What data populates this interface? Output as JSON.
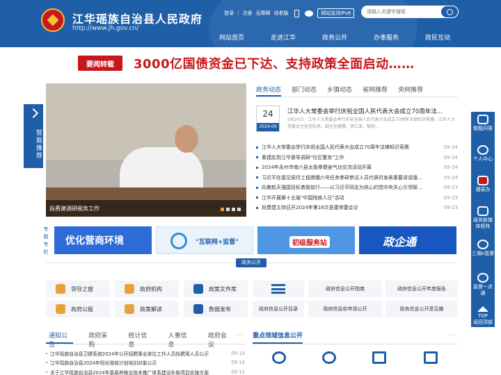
{
  "header": {
    "title": "江华瑶族自治县人民政府",
    "url": "http://www.jh.gov.cn/",
    "links": [
      "登录",
      "注册",
      "无障碍",
      "适老版"
    ],
    "separator": "|",
    "ipv6": "网站支持IPv6",
    "search_placeholder": "请输入关键字搜索",
    "nav": [
      "网站首页",
      "走进江华",
      "政务公开",
      "办事服务",
      "政民互动"
    ]
  },
  "banner": {
    "tag": "要闻转载",
    "headline": "3000亿国债资金已下达、支持政策全面启动……"
  },
  "slideshow": {
    "caption": "段费建调研税务工作"
  },
  "left_float": "智能推荐",
  "news_tabs": [
    "政务动态",
    "部门动态",
    "乡镇动态",
    "省网推荐",
    "央网推荐"
  ],
  "top_news": {
    "day": "24",
    "ym": "2024-09",
    "title": "江华人大常委会举行庆祝全国人民代表大会成立70周年法...",
    "summary": "9月20日，江华人大常委会举行庆祝全国人民代表大会成立70周年法律知识竞赛。江华人大常委会主任任陈承，副主任唐蕾，钟江波，黎刚..."
  },
  "news_list": [
    {
      "title": "江华人大常委会举行庆祝全国人民代表大会成立70周年法律知识竞赛",
      "date": "09-24"
    },
    {
      "title": "秦建彪到江华督导调研\"社区警务\"工作",
      "date": "09-24"
    },
    {
      "title": "2024年永州市南六县太极拳健身气功交流活动开幕",
      "date": "09-24"
    },
    {
      "title": "习近平在接见探月工程嫦娥六号任务参研参试人员代表时发表重要讲话强...",
      "date": "09-24"
    },
    {
      "title": "向着航天强国目标勇毅前行——以习近平同志为核心的党中央关心引领探...",
      "date": "09-23"
    },
    {
      "title": "江华开展第十五届\"中国残疾人日\"活动",
      "date": "09-23"
    },
    {
      "title": "段费建主持召开2024年第18次县委常委会议",
      "date": "09-23"
    }
  ],
  "special_label": "专题专栏",
  "promos": [
    "优化营商环境",
    "\"互联网+监督\"",
    "初级服务站",
    "政企通"
  ],
  "section_title": "政务公开",
  "services": {
    "left": [
      "领导之窗",
      "政府机构",
      "政策文件库",
      "政府公报",
      "政策解读",
      "数据发布"
    ],
    "right": [
      "政府信息公开指南",
      "政府信息公开年度报告",
      "政府信息公开目录",
      "政府信息依申请公开",
      "政务信息公开意见箱"
    ]
  },
  "bottom_tabs": [
    "通知公告",
    "政府采购",
    "统计信息",
    "人事信息",
    "政府会议"
  ],
  "more": "···",
  "notices": [
    {
      "title": "江华瑶族自治县卫健系统2024年公开招聘事业单位工作人员拟聘用人员公示",
      "date": "09-19"
    },
    {
      "title": "江华瑶族自治县2024年阳光增收计划培训对象公示",
      "date": "09-18"
    },
    {
      "title": "关于江华瑶族自治县2024年基层养殖业技术推广体系建设补助项目实施方案",
      "date": "09-11"
    }
  ],
  "key_fields": {
    "title": "重点领域信息公开"
  },
  "rightbar": [
    "智能问答",
    "个人中心",
    "湘易办",
    "政务新媒体矩阵",
    "三湘e监督",
    "监督一点通",
    "TOP",
    "返回顶部"
  ],
  "colors": {
    "primary": "#1f5fa8",
    "accent": "#c8161d"
  }
}
